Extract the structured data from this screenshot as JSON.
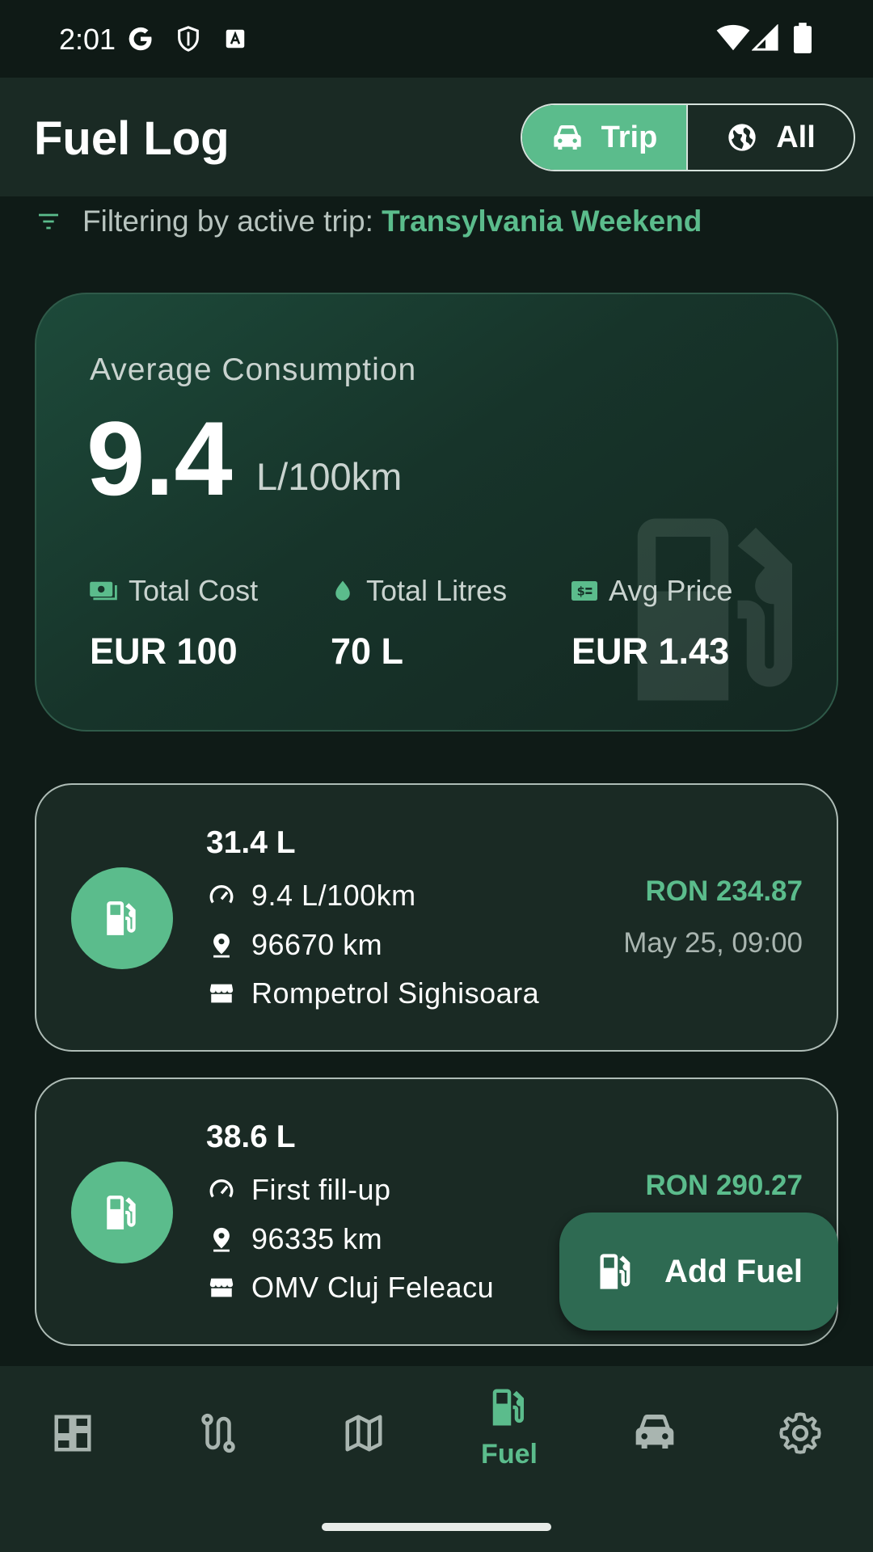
{
  "status_bar": {
    "time": "2:01"
  },
  "app_bar": {
    "title": "Fuel Log",
    "segments": [
      {
        "label": "Trip",
        "icon": "car-icon",
        "selected": true
      },
      {
        "label": "All",
        "icon": "globe-icon",
        "selected": false
      }
    ]
  },
  "filter": {
    "prefix": "Filtering by active trip: ",
    "trip_name": "Transylvania Weekend"
  },
  "summary": {
    "label": "Average Consumption",
    "value": "9.4",
    "unit": "L/100km",
    "stats": [
      {
        "label": "Total Cost",
        "icon": "money-icon",
        "value": "EUR 100"
      },
      {
        "label": "Total Litres",
        "icon": "drop-icon",
        "value": "70 L"
      },
      {
        "label": "Avg Price",
        "icon": "price-tag-icon",
        "value": "EUR 1.43"
      }
    ]
  },
  "entries": [
    {
      "litres": "31.4 L",
      "consumption": "9.4 L/100km",
      "odometer": "96670 km",
      "station": "Rompetrol Sighisoara",
      "price": "RON 234.87",
      "date": "May 25, 09:00"
    },
    {
      "litres": "38.6 L",
      "consumption": "First fill-up",
      "odometer": "96335 km",
      "station": "OMV Cluj Feleacu",
      "price": "RON 290.27",
      "date": ""
    }
  ],
  "fab": {
    "label": "Add Fuel"
  },
  "bottom_nav": {
    "items": [
      {
        "name": "dashboard",
        "icon": "dashboard-icon",
        "label": ""
      },
      {
        "name": "trips",
        "icon": "route-icon",
        "label": ""
      },
      {
        "name": "map",
        "icon": "map-icon",
        "label": ""
      },
      {
        "name": "fuel",
        "icon": "fuel-pump-icon",
        "label": "Fuel",
        "active": true
      },
      {
        "name": "vehicles",
        "icon": "car-icon",
        "label": ""
      },
      {
        "name": "settings",
        "icon": "gear-icon",
        "label": ""
      }
    ]
  },
  "colors": {
    "accent": "#5bbc8c",
    "background": "#0f1b17",
    "surface": "#1a2a24",
    "fab": "#2e6a52"
  }
}
